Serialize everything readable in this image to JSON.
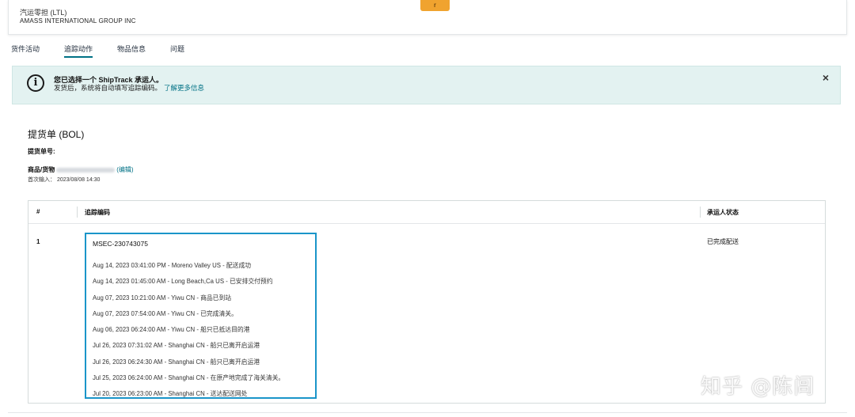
{
  "header": {
    "mode": "汽运零担 (LTL)",
    "company": "AMASS INTERNATIONAL GROUP INC",
    "badge": "r"
  },
  "tabs": [
    {
      "label": "货件活动",
      "active": false
    },
    {
      "label": "追踪动作",
      "active": true
    },
    {
      "label": "物品信息",
      "active": false
    },
    {
      "label": "问题",
      "active": false
    }
  ],
  "alert": {
    "icon": "info-icon",
    "title": "您已选择一个 ShipTrack 承运人。",
    "body": "发货后，系统将自动填写追踪编码。",
    "link": "了解更多信息",
    "close": "×"
  },
  "bol": {
    "title": "提货单 (BOL)",
    "number_label": "提货单号:",
    "goods_label": "商品/货物",
    "edit_link": "(编辑)",
    "first_entry": "首次输入：  2023/08/08 14:30"
  },
  "table": {
    "headers": {
      "num": "#",
      "tracking": "追踪编码",
      "status": "承运人状态"
    },
    "rows": [
      {
        "num": "1",
        "tracking_number": "MSEC-230743075",
        "status": "已完成配送",
        "events": [
          "Aug 14, 2023 03:41:00 PM - Moreno Valley US - 配送成功",
          "Aug 14, 2023 01:45:00 AM - Long Beach,Ca US - 已安排交付预约",
          "Aug 07, 2023 10:21:00 AM - Yiwu CN - 商品已到站",
          "Aug 07, 2023 07:54:00 AM - Yiwu CN - 已完成清关。",
          "Aug 06, 2023 06:24:00 AM - Yiwu CN - 船只已抵达目的港",
          "Jul 26, 2023 07:31:02 AM - Shanghai CN - 船只已离开启运港",
          "Jul 26, 2023 06:24:30 AM - Shanghai CN - 船只已离开启运港",
          "Jul 25, 2023 06:24:00 AM - Shanghai CN - 在原产地完成了海关清关。",
          "Jul 20, 2023 06:23:00 AM - Shanghai CN - 送达配送网处"
        ]
      }
    ]
  },
  "watermark": "知乎 @陈闾"
}
